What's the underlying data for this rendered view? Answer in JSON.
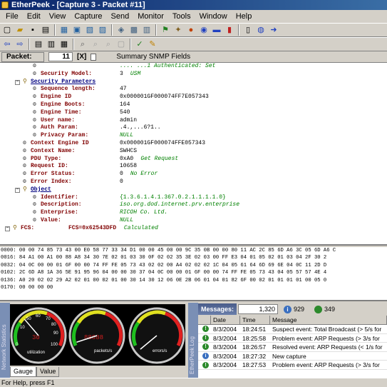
{
  "window": {
    "title": "EtherPeek - [Capture 3 - Packet #11]"
  },
  "menu": [
    "File",
    "Edit",
    "View",
    "Capture",
    "Send",
    "Monitor",
    "Tools",
    "Window",
    "Help"
  ],
  "packetbar": {
    "label": "Packet:",
    "number": "11",
    "x_label": "[X]",
    "summary": "Summary SNMP Fields"
  },
  "decode": {
    "rows": [
      {
        "indent": 3,
        "label": "",
        "value": ".... ...1 Authenticated: Set",
        "note": true
      },
      {
        "indent": 3,
        "label": "Security Model:",
        "value": "3",
        "note_text": "USM"
      },
      {
        "indent": 2,
        "label": "Security Parameters",
        "value": "",
        "group": true
      },
      {
        "indent": 3,
        "label": "Sequence length:",
        "value": "47"
      },
      {
        "indent": 3,
        "label": "Engine ID",
        "value": "0x000001GF000074FF7E057343"
      },
      {
        "indent": 3,
        "label": "Engine Boots:",
        "value": "164"
      },
      {
        "indent": 3,
        "label": "Engine Time:",
        "value": "540"
      },
      {
        "indent": 3,
        "label": "User name:",
        "value": "admin"
      },
      {
        "indent": 3,
        "label": "Auth Param:",
        "value": ".4.,...6?1.."
      },
      {
        "indent": 3,
        "label": "Privacy Param:",
        "value": "NULL",
        "italic": true
      },
      {
        "indent": 2,
        "label": "Context Engine ID",
        "value": "0x000001GF000074FFE057343"
      },
      {
        "indent": 2,
        "label": "Context Name:",
        "value": "SWHCS"
      },
      {
        "indent": 2,
        "label": "PDU Type:",
        "value": "0xA0",
        "note_text": "Get Request"
      },
      {
        "indent": 2,
        "label": "Request ID:",
        "value": "10658"
      },
      {
        "indent": 2,
        "label": "Error Status:",
        "value": "0",
        "note_text": "No Error"
      },
      {
        "indent": 2,
        "label": "Error Index:",
        "value": "0"
      },
      {
        "indent": 2,
        "label": "Object",
        "value": "",
        "group": true
      },
      {
        "indent": 3,
        "label": "Identifier:",
        "value": "{1.3.6.1.4.1.367.0.2.1.1.1.1.0}",
        "blue": true
      },
      {
        "indent": 3,
        "label": "Description:",
        "value": "iso.org.dod.internet.prv.enterprise",
        "italic": true
      },
      {
        "indent": 3,
        "label": "Enterprise:",
        "value": "RICOH Co. Ltd.",
        "italic": true
      },
      {
        "indent": 3,
        "label": "Value:",
        "value": "NULL",
        "italic": true
      },
      {
        "indent": 1,
        "label": "FCS:",
        "value": "FCS=0x62543DFD",
        "note_text": "Calculated",
        "fcs": true
      }
    ]
  },
  "hex": {
    "rows": [
      "0000: 00 00 74 85 73 43 00 E0 58 77 33 34 D1 00 00 45 00 00 9C 35 0B 00 00 80 11 AC 2C 85 6D A6 3C 05 6D A6 C",
      "0016: 84 A1 00 A1 00 88 A8 34 30 7E 02 01 03 30 0F 02 02 35 3E 02 03 00 FF E3 04 01 05 02 01 03 04 2F 30 2",
      "0032: 04 0C 00 00 01 6F 00 00 74 FF FE 05 73 43 02 02 00 A4 02 02 02 1C 04 05 61 64 6D 69 6E 04 0C 11 2D D",
      "0102: 2C 6D A8 1A 36 5E 91 95 96 04 00 00 30 37 04 0C 00 00 01 6F 00 00 74 FF FE 05 73 43 04 05 57 57 4E 4",
      "0136: A0 20 02 02 29 A2 02 01 00 02 01 00 30 14 30 12 06 0E 2B 06 01 04 01 82 6F 00 02 01 01 01 01 00 05 0",
      "0170: 00 00 00 00"
    ]
  },
  "gauges": {
    "items": [
      {
        "label": "utilization",
        "digits": "30",
        "reading": 0.35
      },
      {
        "label": "packets/s",
        "digits": "88888",
        "reading": 0.1
      },
      {
        "label": "errors/s",
        "digits": "",
        "reading": 0.02
      }
    ],
    "scale_a": [
      "0",
      "10",
      "50",
      "60",
      "70",
      "80",
      "90",
      "100"
    ],
    "tabs": [
      "Gauge",
      "Value"
    ],
    "side_label": "Network Statistics"
  },
  "messages": {
    "title": "Messages:",
    "count": "1,320",
    "info_count": "929",
    "warn_count": "349",
    "columns": [
      "",
      "Date",
      "Time",
      "Message"
    ],
    "rows": [
      {
        "date": "8/3/2004",
        "time": "18:24:51",
        "message": "Suspect event: Total Broadcast (> 5/s for"
      },
      {
        "date": "8/3/2004",
        "time": "18:25:58",
        "message": "Problem event: ARP Requests (> 3/s for"
      },
      {
        "date": "8/3/2004",
        "time": "18:26:57",
        "message": "Resolved event: ARP Requests (< 1/s for"
      },
      {
        "date": "8/3/2004",
        "time": "18:27:32",
        "message": "New capture"
      },
      {
        "date": "8/3/2004",
        "time": "18:27:53",
        "message": "Problem event: ARP Requests (> 3/s for"
      }
    ],
    "side_label": "EtherPeek Log"
  },
  "status": {
    "text": "For Help, press F1"
  },
  "colors": {
    "title_start": "#0a246a",
    "title_end": "#3a6ea5",
    "label_red": "#800000",
    "note_green": "#008000"
  }
}
